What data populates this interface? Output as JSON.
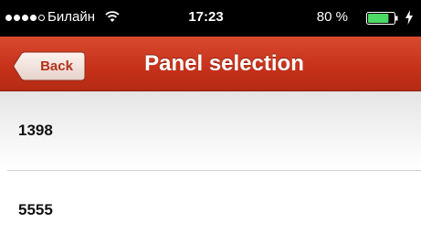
{
  "status_bar": {
    "carrier": "Билайн",
    "time": "17:23",
    "battery_percent": "80 %",
    "signal_bars_filled": 4,
    "signal_bars_total": 5,
    "battery_level": 0.8
  },
  "nav": {
    "back_label": "Back",
    "title": "Panel selection"
  },
  "list": {
    "items": [
      {
        "label": "1398"
      },
      {
        "label": "5555"
      }
    ]
  },
  "colors": {
    "nav_bar": "#c7321b",
    "status_bar": "#000000",
    "battery_fill": "#4cd964"
  }
}
